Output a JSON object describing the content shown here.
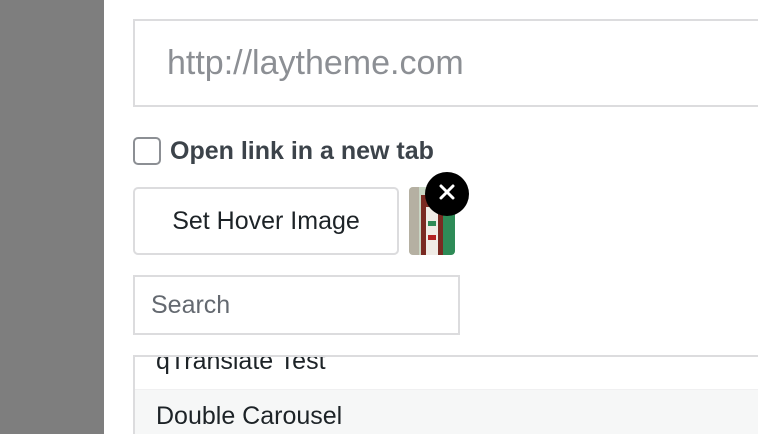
{
  "link": {
    "url_placeholder": "http://laytheme.com",
    "new_tab_label": "Open link in a new tab"
  },
  "hover_image": {
    "button_label": "Set Hover Image",
    "remove_icon": "close-icon",
    "thumbnail_colors": [
      "#2e8b57",
      "#a52a2a",
      "#f5f5f5"
    ]
  },
  "search": {
    "placeholder": "Search"
  },
  "results": [
    {
      "label": "qTranslate Test"
    },
    {
      "label": "Double Carousel"
    }
  ]
}
